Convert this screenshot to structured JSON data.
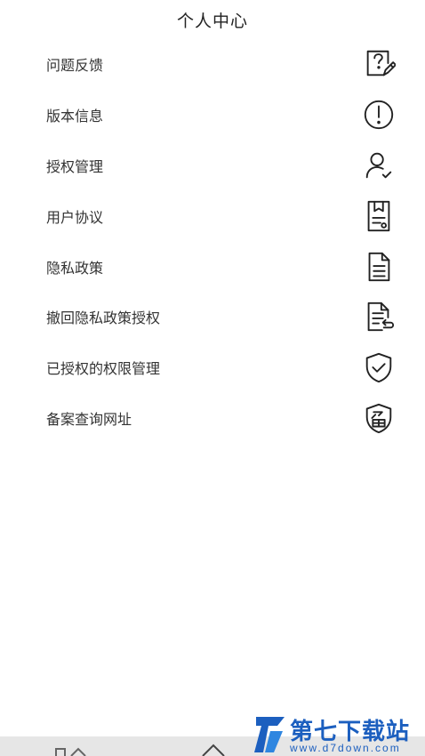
{
  "header": {
    "title": "个人中心"
  },
  "menu": {
    "items": [
      {
        "label": "问题反馈",
        "icon": "feedback-edit-icon"
      },
      {
        "label": "版本信息",
        "icon": "exclamation-circle-icon"
      },
      {
        "label": "授权管理",
        "icon": "user-check-icon"
      },
      {
        "label": "用户协议",
        "icon": "agreement-document-icon"
      },
      {
        "label": "隐私政策",
        "icon": "document-icon"
      },
      {
        "label": "撤回隐私政策授权",
        "icon": "document-revoke-icon"
      },
      {
        "label": "已授权的权限管理",
        "icon": "shield-check-icon"
      },
      {
        "label": "备案查询网址",
        "icon": "filing-shield-icon"
      }
    ]
  },
  "watermark": {
    "text": "第七下载站",
    "url": "www.d7down.com"
  },
  "colors": {
    "text": "#333333",
    "icon": "#222222",
    "watermark": "#1c5fbf",
    "bottom_bar": "#e6e6e6"
  }
}
